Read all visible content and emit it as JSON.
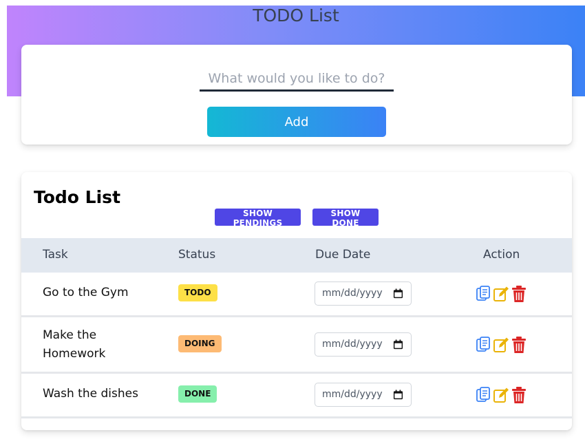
{
  "header": {
    "title": "TODO List"
  },
  "form": {
    "placeholder": "What would you like to do?",
    "value": "",
    "add_label": "Add"
  },
  "list": {
    "title": "Todo List",
    "filters": {
      "pending_label": "SHOW PENDINGS",
      "done_label": "SHOW DONE"
    },
    "columns": [
      "Task",
      "Status",
      "Due Date",
      "Action"
    ],
    "rows": [
      {
        "task": "Go to the Gym",
        "status": "TODO",
        "due": "mm/dd/yyyy"
      },
      {
        "task": "Make the Homework",
        "status": "DOING",
        "due": "mm/dd/yyyy"
      },
      {
        "task": "Wash the dishes",
        "status": "DONE",
        "due": "mm/dd/yyyy"
      }
    ]
  },
  "icons": {
    "copy": "clipboard-copy-icon",
    "edit": "pencil-edit-icon",
    "delete": "trash-icon",
    "calendar": "calendar-icon"
  },
  "colors": {
    "gradient_start": "#c084fc",
    "gradient_end": "#3b82f6",
    "filter_button": "#4f46e5",
    "badge_todo": "#fde047",
    "badge_doing": "#fdba74",
    "badge_done": "#86efac",
    "copy_icon": "#3b82f6",
    "edit_icon": "#eab308",
    "delete_icon": "#dc2626"
  }
}
